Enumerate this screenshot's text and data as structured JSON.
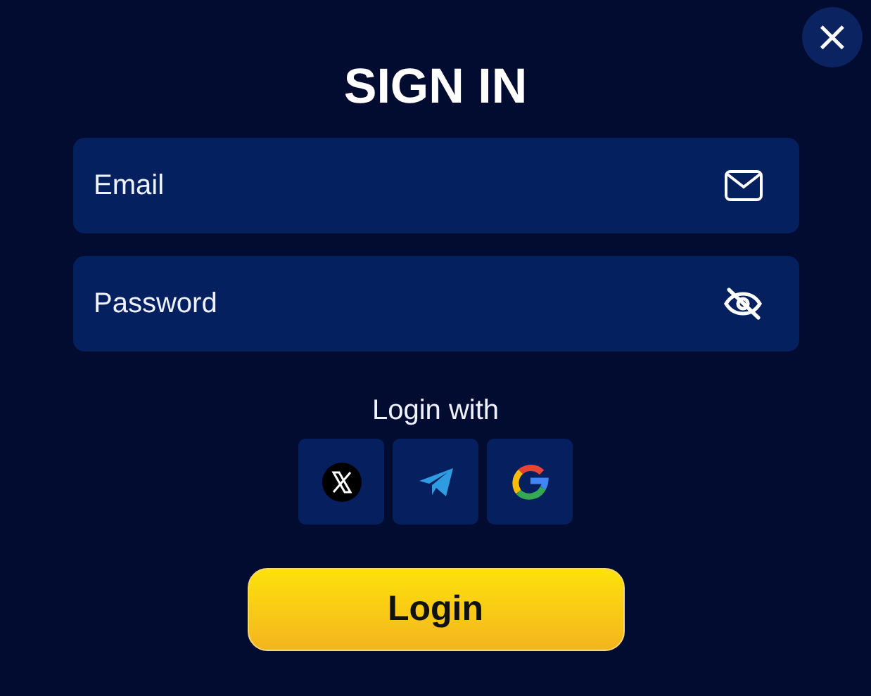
{
  "dialog": {
    "title": "SIGN IN",
    "close": "×"
  },
  "fields": [
    {
      "kind": "email",
      "placeholder": "Email"
    },
    {
      "kind": "password",
      "placeholder": "Password"
    }
  ],
  "social": {
    "label": "Login with",
    "providers": [
      {
        "kind": "x"
      },
      {
        "kind": "telegram"
      },
      {
        "kind": "google"
      }
    ]
  },
  "submit": "Login"
}
